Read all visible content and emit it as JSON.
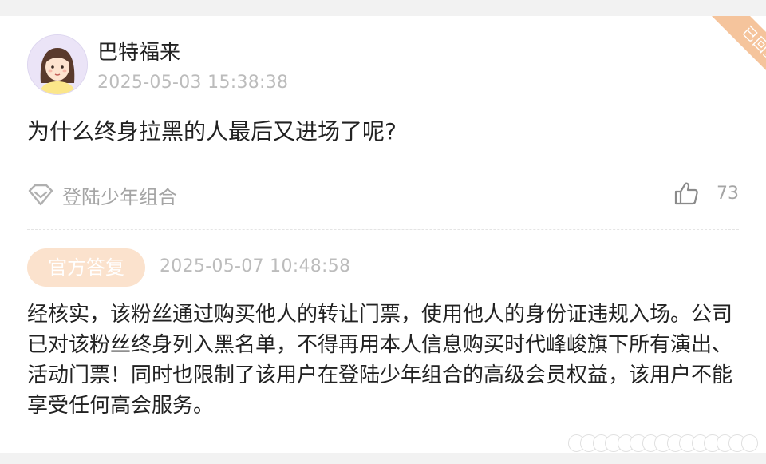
{
  "post": {
    "username": "巴特福来",
    "timestamp": "2025-05-03 15:38:38",
    "status_ribbon": "已回复",
    "question": "为什么终身拉黑的人最后又进场了呢?",
    "topic": "登陆少年组合",
    "topic_icon": "diamond-icon",
    "like_icon": "thumbs-up-icon",
    "like_count": "73"
  },
  "reply": {
    "badge": "官方答复",
    "timestamp": "2025-05-07 10:48:58",
    "text": "经核实，该粉丝通过购买他人的转让门票，使用他人的身份证违规入场。公司已对该粉丝终身列入黑名单，不得再用本人信息购买时代峰峻旗下所有演出、活动门票！同时也限制了该用户在登陆少年组合的高级会员权益，该用户不能享受任何高会服务。"
  },
  "colors": {
    "accent_orange": "#f5c49c",
    "badge_bg": "#fbe2cd",
    "muted_text": "#bcbcbc",
    "body_text": "#222222"
  }
}
